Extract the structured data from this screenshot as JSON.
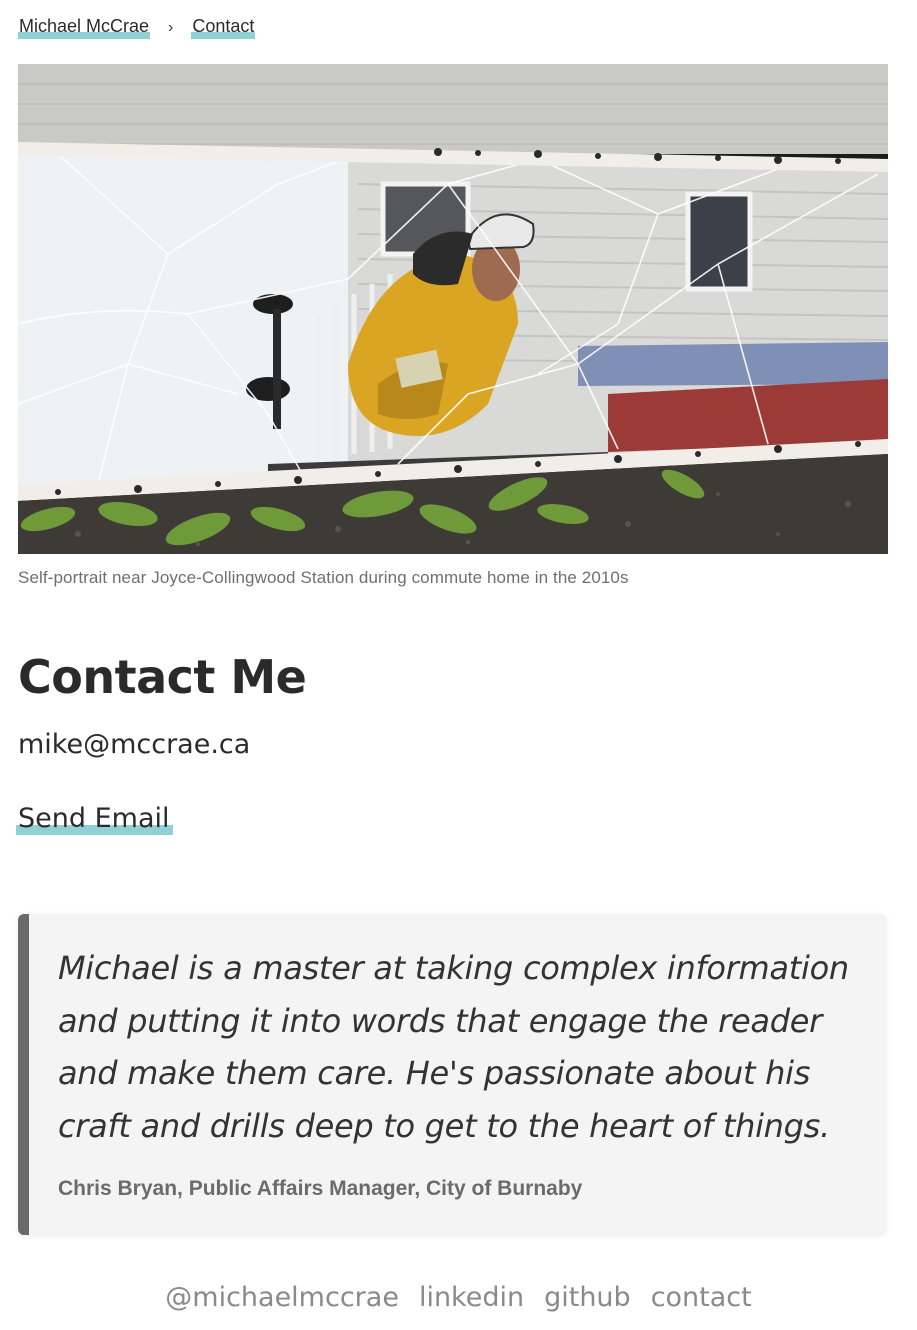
{
  "breadcrumb": {
    "home": "Michael McCrae",
    "separator": "›",
    "current": "Contact"
  },
  "hero": {
    "caption": "Self-portrait near Joyce-Collingwood Station during commute home in the 2010s"
  },
  "contact": {
    "title": "Contact Me",
    "email": "mike@mccrae.ca",
    "send_label": "Send Email"
  },
  "testimonial": {
    "quote": "Michael is a master at taking complex information and putting it into words that engage the reader and make them care. He's passionate about his craft and drills deep to get to the heart of things.",
    "attribution": "Chris Bryan, Public Affairs Manager, City of Burnaby"
  },
  "footer": {
    "links": [
      "@michaelmccrae",
      "linkedin",
      "github",
      "contact"
    ]
  },
  "colors": {
    "link_underline": "#8fd1d6",
    "quote_border": "#6a6a6a",
    "quote_bg": "#f4f4f4"
  }
}
